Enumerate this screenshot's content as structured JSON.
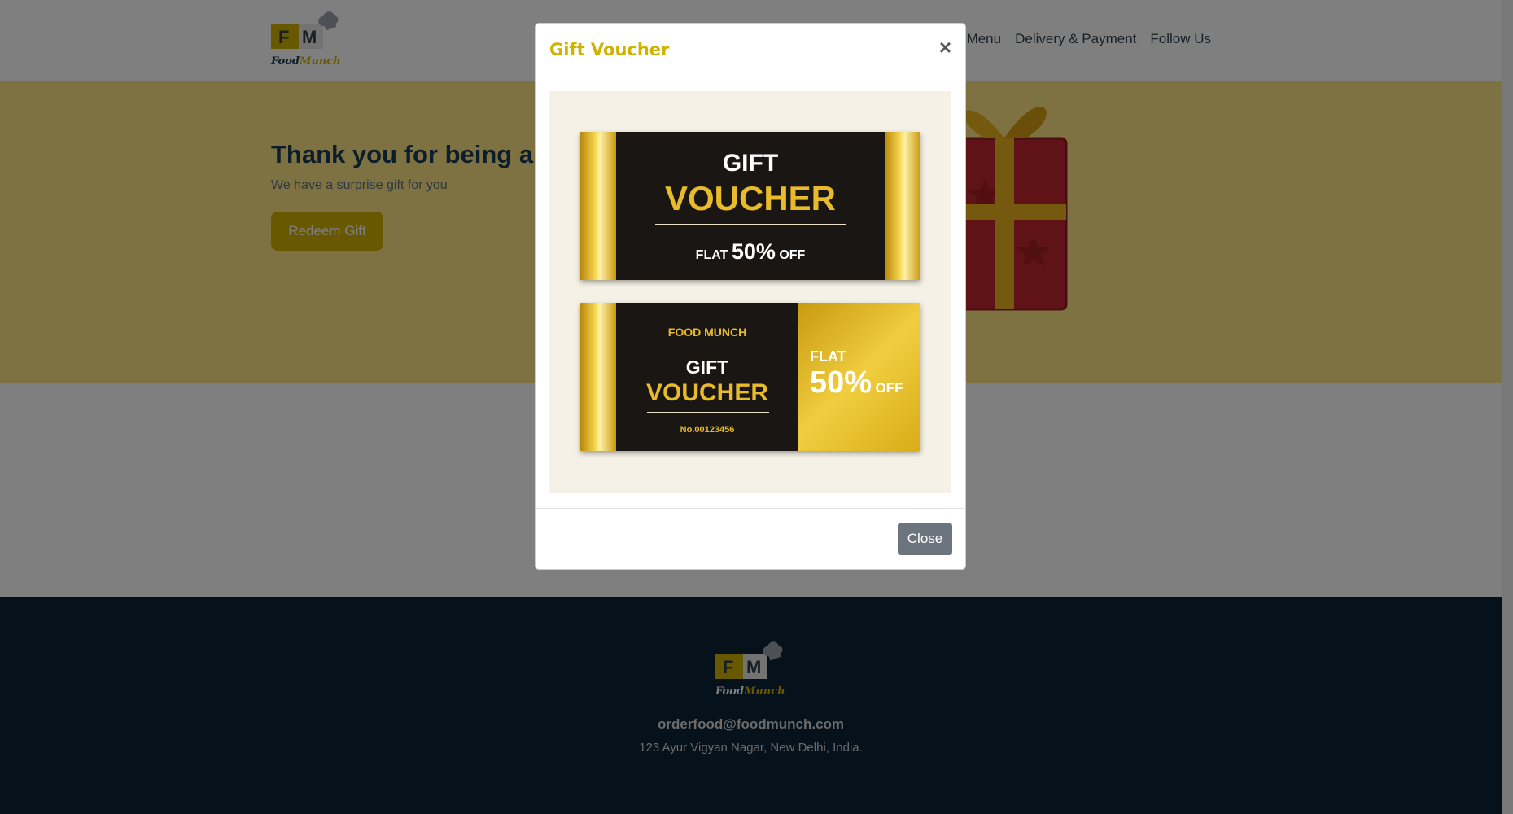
{
  "navbar": {
    "logo": {
      "letter_f": "F",
      "letter_m": "M",
      "word_food": "Food",
      "word_munch": "Munch"
    },
    "links": [
      "Explore Menu",
      "Delivery & Payment",
      "Follow Us"
    ]
  },
  "hero": {
    "title": "Thank you for being a valued customer",
    "subtitle": "We have a surprise gift for you",
    "redeem_label": "Redeem Gift"
  },
  "modal": {
    "title": "Gift Voucher",
    "close_x": "×",
    "close_label": "Close",
    "voucher1": {
      "line1": "GIFT",
      "line2": "VOUCHER",
      "flat": "FLAT",
      "percent": "50%",
      "off": "OFF"
    },
    "voucher2": {
      "brand": "FOOD MUNCH",
      "line1": "GIFT",
      "line2": "VOUCHER",
      "number": "No.00123456",
      "flat": "FLAT",
      "percent": "50%",
      "off": "OFF"
    }
  },
  "footer": {
    "logo": {
      "letter_f": "F",
      "letter_m": "M",
      "word_food": "Food",
      "word_munch": "Munch"
    },
    "email": "orderfood@foodmunch.com",
    "address": "123 Ayur Vigyan Nagar, New Delhi, India."
  },
  "colors": {
    "brand_gold": "#d0b200",
    "dark_blue": "#183b56",
    "footer_bg": "#0d2436",
    "hero_bg": "#fde585"
  }
}
